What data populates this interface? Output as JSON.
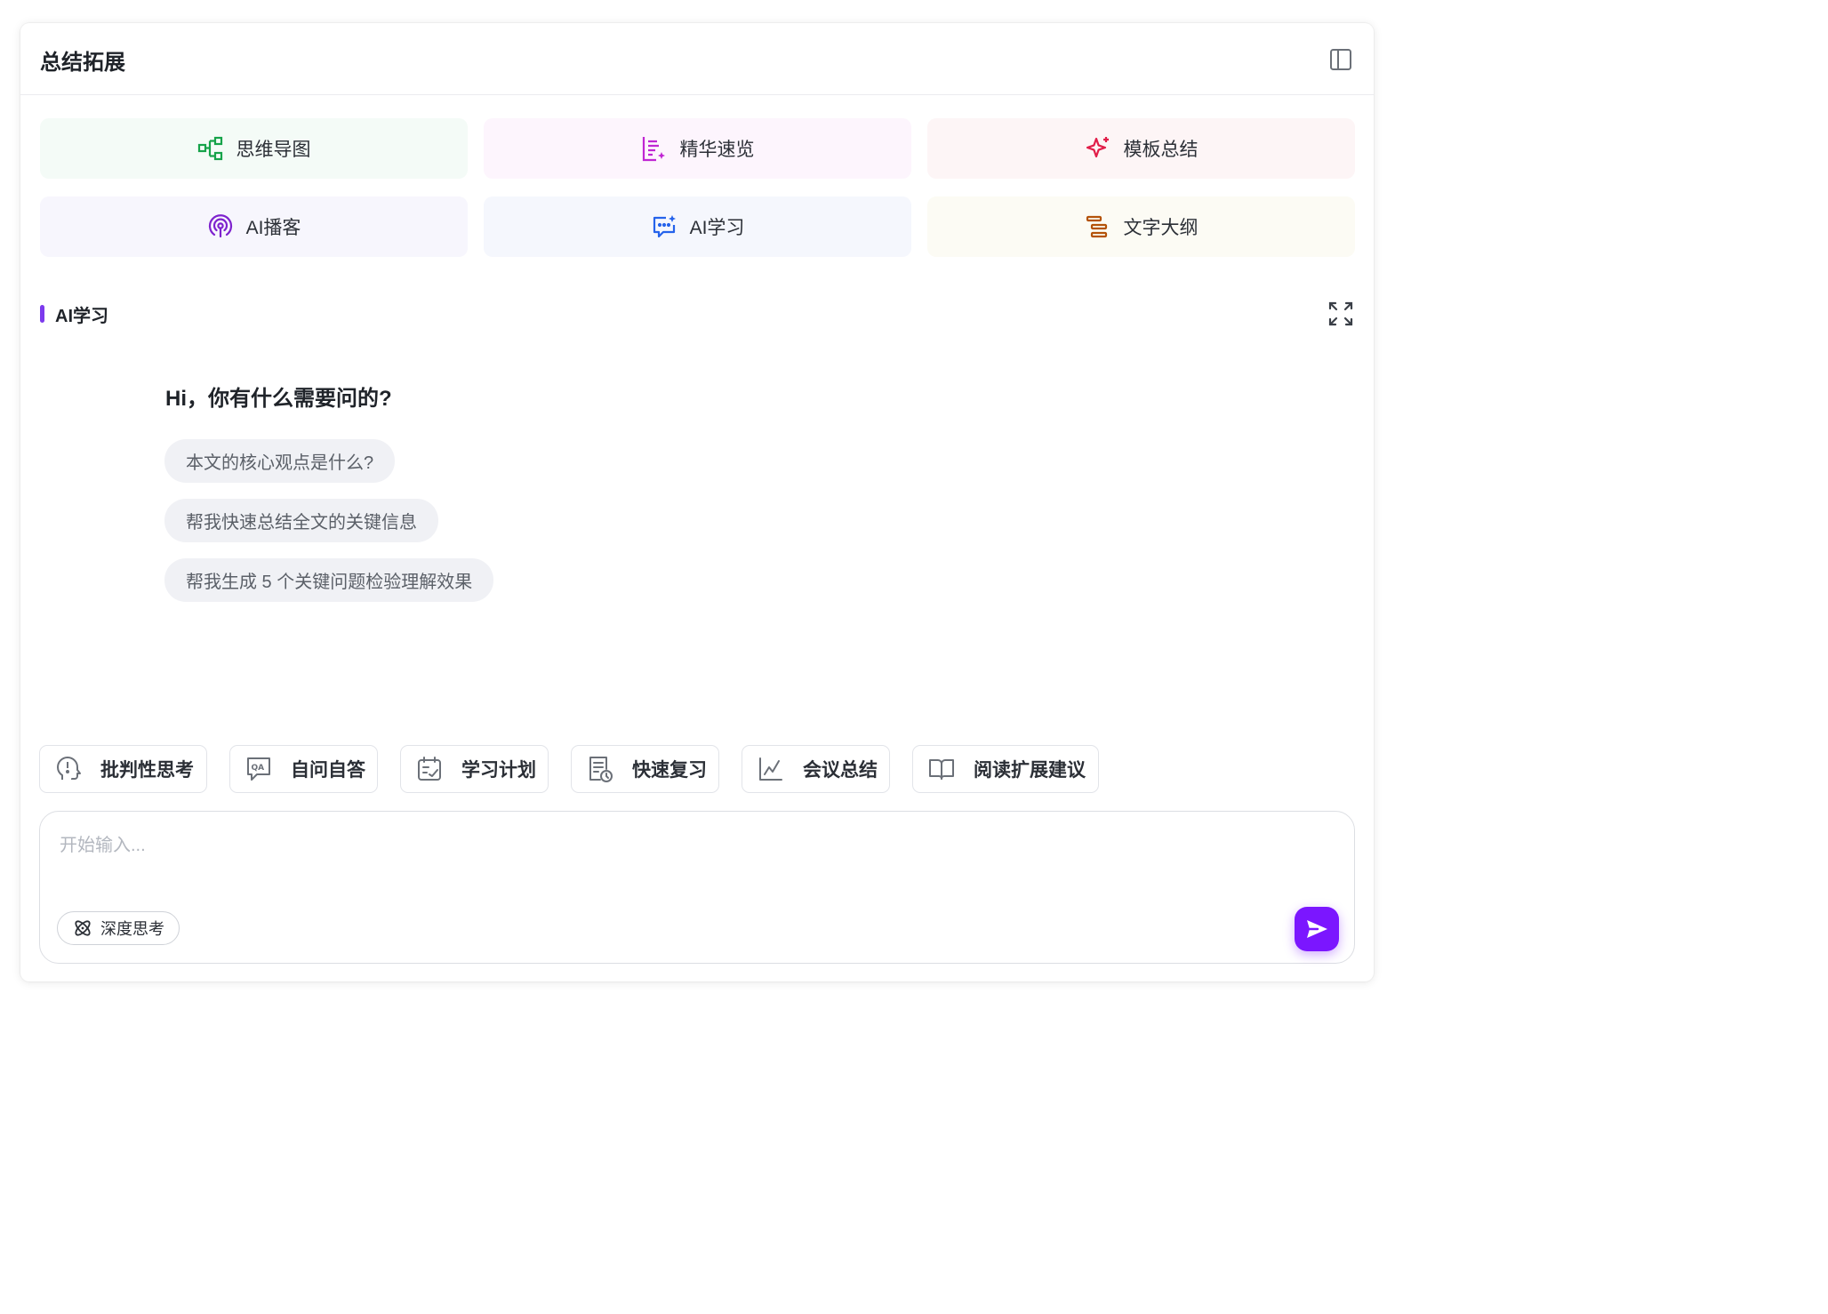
{
  "header": {
    "title": "总结拓展"
  },
  "tools": [
    {
      "label": "思维导图",
      "icon": "mind-map-icon",
      "bg": "#f3fbf7",
      "color": "#16a34a"
    },
    {
      "label": "精华速览",
      "icon": "highlights-icon",
      "bg": "#fdf5fd",
      "color": "#c026d3"
    },
    {
      "label": "模板总结",
      "icon": "sparkle-icon",
      "bg": "#fdf5f6",
      "color": "#e11d48"
    },
    {
      "label": "AI播客",
      "icon": "podcast-icon",
      "bg": "#f7f6fd",
      "color": "#7e22ce"
    },
    {
      "label": "AI学习",
      "icon": "ai-chat-icon",
      "bg": "#f5f7fd",
      "color": "#2563eb"
    },
    {
      "label": "文字大纲",
      "icon": "outline-icon",
      "bg": "#fcfbf5",
      "color": "#b45309"
    }
  ],
  "section": {
    "title": "AI学习"
  },
  "chat": {
    "greeting": "Hi，你有什么需要问的?",
    "suggestions": [
      "本文的核心观点是什么?",
      "帮我快速总结全文的关键信息",
      "帮我生成 5 个关键问题检验理解效果"
    ]
  },
  "quick_actions": [
    {
      "label": "批判性思考",
      "icon": "head-idea-icon"
    },
    {
      "label": "自问自答",
      "icon": "qa-icon"
    },
    {
      "label": "学习计划",
      "icon": "calendar-plan-icon"
    },
    {
      "label": "快速复习",
      "icon": "review-clock-icon"
    },
    {
      "label": "会议总结",
      "icon": "line-chart-icon"
    },
    {
      "label": "阅读扩展建议",
      "icon": "open-book-icon"
    }
  ],
  "input": {
    "placeholder": "开始输入...",
    "deep_think_label": "深度思考"
  },
  "colors": {
    "accent": "#7b16ff",
    "section_bar": "#7c3aed"
  }
}
